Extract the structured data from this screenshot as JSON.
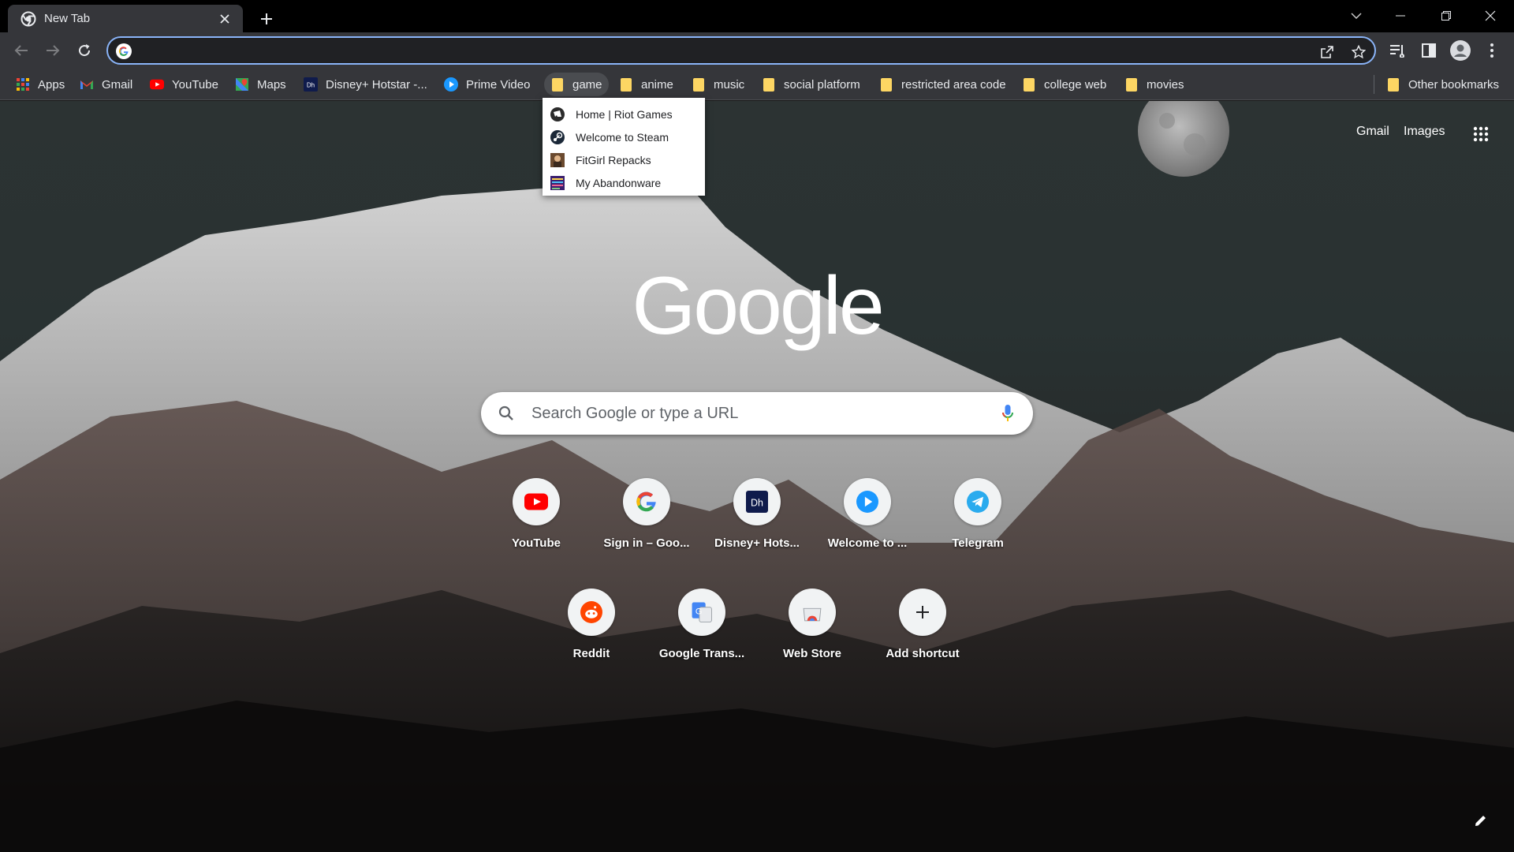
{
  "tab": {
    "title": "New Tab"
  },
  "omnibox": {
    "value": ""
  },
  "bookmarks": [
    {
      "label": "Apps",
      "icon": "apps-grid-icon"
    },
    {
      "label": "Gmail",
      "icon": "gmail-icon"
    },
    {
      "label": "YouTube",
      "icon": "youtube-icon"
    },
    {
      "label": "Maps",
      "icon": "maps-icon"
    },
    {
      "label": "Disney+ Hotstar -...",
      "icon": "hotstar-icon"
    },
    {
      "label": "Prime Video",
      "icon": "prime-video-icon"
    },
    {
      "label": "game",
      "icon": "folder-icon"
    },
    {
      "label": "anime",
      "icon": "folder-icon"
    },
    {
      "label": "music",
      "icon": "folder-icon"
    },
    {
      "label": "social platform",
      "icon": "folder-icon"
    },
    {
      "label": "restricted area code",
      "icon": "folder-icon"
    },
    {
      "label": "college web",
      "icon": "folder-icon"
    },
    {
      "label": "movies",
      "icon": "folder-icon"
    }
  ],
  "other_bookmarks": "Other bookmarks",
  "dropdown": {
    "items": [
      {
        "label": "Home | Riot Games",
        "icon": "riot-games-icon"
      },
      {
        "label": "Welcome to Steam",
        "icon": "steam-icon"
      },
      {
        "label": "FitGirl Repacks",
        "icon": "fitgirl-icon"
      },
      {
        "label": "My Abandonware",
        "icon": "abandonware-icon"
      }
    ]
  },
  "ntp": {
    "gmail_link": "Gmail",
    "images_link": "Images",
    "search_placeholder": "Search Google or type a URL",
    "shortcuts": [
      {
        "label": "YouTube",
        "icon": "youtube-icon"
      },
      {
        "label": "Sign in – Goo...",
        "icon": "google-icon"
      },
      {
        "label": "Disney+ Hots...",
        "icon": "hotstar-icon"
      },
      {
        "label": "Welcome to ...",
        "icon": "prime-video-icon"
      },
      {
        "label": "Telegram",
        "icon": "telegram-icon"
      },
      {
        "label": "Reddit",
        "icon": "reddit-icon"
      },
      {
        "label": "Google Trans...",
        "icon": "google-translate-icon"
      },
      {
        "label": "Web Store",
        "icon": "web-store-icon"
      },
      {
        "label": "Add shortcut",
        "icon": "plus-icon"
      }
    ]
  },
  "colors": {
    "accent": "#8ab4f8",
    "toolbar": "#35363a",
    "tabstrip": "#000000",
    "folder": "#fdd663"
  }
}
